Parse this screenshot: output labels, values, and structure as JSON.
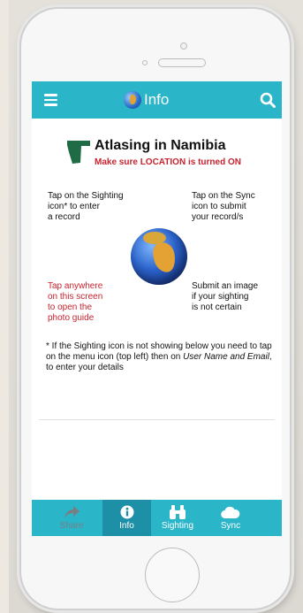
{
  "header": {
    "title": "Info",
    "menu_icon": "hamburger-menu-icon",
    "search_icon": "search-icon",
    "accent_color": "#2ab5c9"
  },
  "main": {
    "heading": "Atlasing in Namibia",
    "subheading": "Make sure LOCATION is turned ON",
    "tap_sighting": "Tap on the Sighting\nicon* to enter\na record",
    "tap_sync": "Tap on the Sync\nicon to submit\nyour record/s",
    "tap_anywhere": "Tap anywhere\non this screen\nto open the\nphoto guide",
    "submit_image": "Submit an image\nif your sighting\nis not certain",
    "note_main": "* If the Sighting icon is not showing below you need to tap on the menu icon (top left) then on ",
    "note_italic": "User Name and Email",
    "note_end": ", to enter your details"
  },
  "nav": {
    "items": [
      {
        "label": "Share",
        "icon": "share-arrow-icon"
      },
      {
        "label": "Info",
        "icon": "info-circle-icon",
        "active": true
      },
      {
        "label": "Sighting",
        "icon": "binoculars-icon"
      },
      {
        "label": "Sync",
        "icon": "cloud-icon"
      }
    ]
  }
}
